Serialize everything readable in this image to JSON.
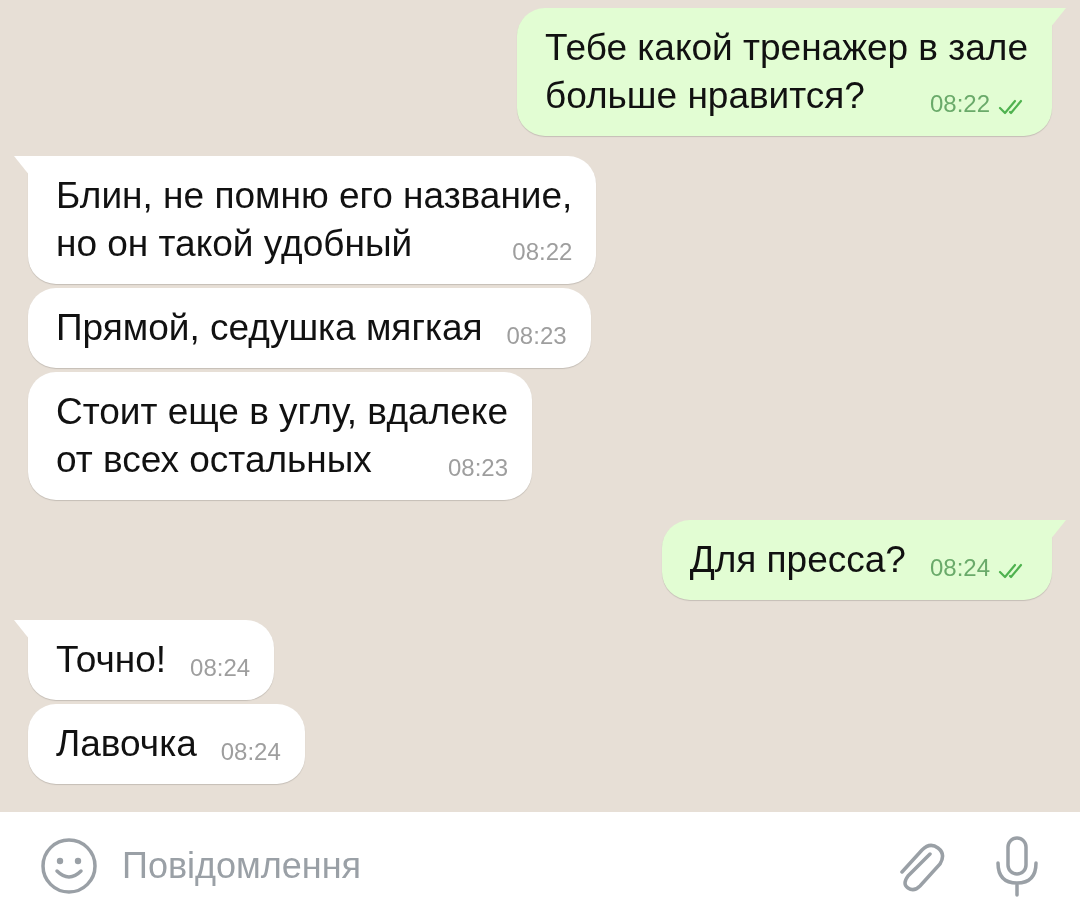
{
  "messages": [
    {
      "outgoing": true,
      "tail": true,
      "lines": [
        "Тебе какой тренажер в зале",
        "больше нравится?"
      ],
      "time": "08:22",
      "read": true
    },
    {
      "outgoing": false,
      "tail": true,
      "lines": [
        "Блин, не помню его название,",
        "но он такой удобный"
      ],
      "time": "08:22"
    },
    {
      "outgoing": false,
      "tail": false,
      "lines": [
        "Прямой, седушка мягкая"
      ],
      "time": "08:23"
    },
    {
      "outgoing": false,
      "tail": false,
      "lines": [
        "Стоит еще в углу, вдалеке",
        "от всех остальных"
      ],
      "time": "08:23"
    },
    {
      "outgoing": true,
      "tail": true,
      "lines": [
        "Для пресса?"
      ],
      "time": "08:24",
      "read": true
    },
    {
      "outgoing": false,
      "tail": true,
      "lines": [
        "Точно!"
      ],
      "time": "08:24"
    },
    {
      "outgoing": false,
      "tail": false,
      "lines": [
        "Лавочка"
      ],
      "time": "08:24"
    }
  ],
  "composer": {
    "placeholder": "Повідомлення"
  }
}
